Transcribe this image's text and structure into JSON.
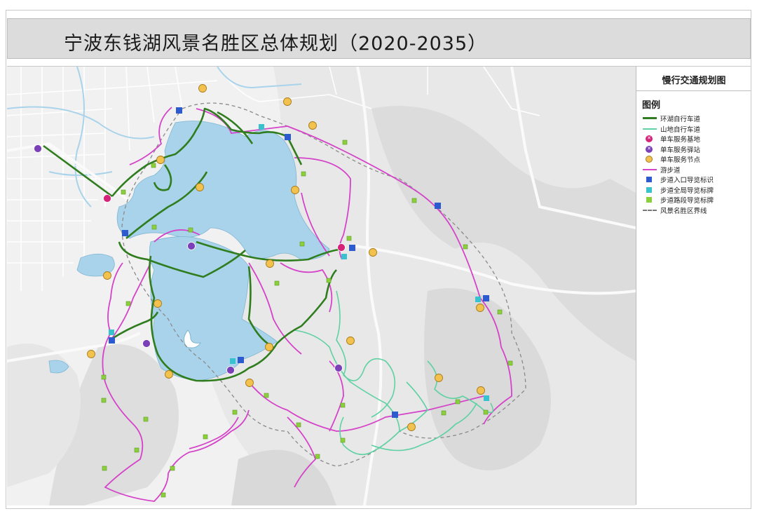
{
  "title": "宁波东钱湖风景名胜区总体规划（2020-2035）",
  "map": {
    "panel_title": "慢行交通规划图",
    "legend_heading": "图例",
    "legend": [
      {
        "label": "环湖自行车道",
        "symbol": "line",
        "color": "#2f7d1f",
        "icon": "bike-loop-line"
      },
      {
        "label": "山地自行车道",
        "symbol": "line",
        "color": "#5fd1a3",
        "icon": "mountain-bike-line"
      },
      {
        "label": "单车服务基地",
        "symbol": "circle",
        "color": "#d6237a",
        "icon": "bike-service-base-icon"
      },
      {
        "label": "单车服务驿站",
        "symbol": "circle",
        "color": "#7b3fb8",
        "icon": "bike-service-station-icon"
      },
      {
        "label": "单车服务节点",
        "symbol": "circle",
        "color": "#f2c14e",
        "icon": "bike-service-node-icon"
      },
      {
        "label": "游步道",
        "symbol": "line",
        "color": "#d443c8",
        "icon": "trail-line"
      },
      {
        "label": "步道入口导览标识",
        "symbol": "square",
        "color": "#2c5bd0",
        "icon": "trail-entrance-sign-icon"
      },
      {
        "label": "步道全局导览标牌",
        "symbol": "square",
        "color": "#38c2cf",
        "icon": "trail-global-sign-icon"
      },
      {
        "label": "步道路段导览标牌",
        "symbol": "square",
        "color": "#8ccf3c",
        "icon": "trail-section-sign-icon"
      },
      {
        "label": "风景名胜区界线",
        "symbol": "dash",
        "color": "#777777",
        "icon": "scenic-boundary-line"
      }
    ],
    "colors": {
      "lake": "#a9d3ea",
      "road": "#ffffff",
      "terrain": "#e2e2e2",
      "green_route": "#2f7d1f",
      "mint_route": "#5fd1a3",
      "pink_route": "#d443c8"
    }
  }
}
